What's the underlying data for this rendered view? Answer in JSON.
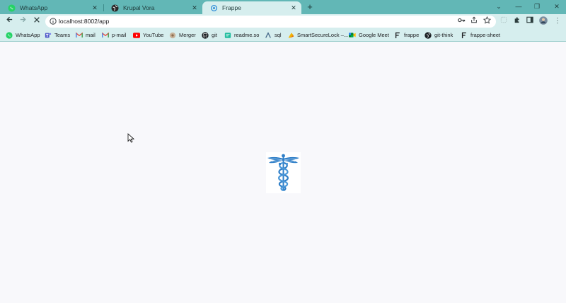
{
  "tabs": [
    {
      "title": "WhatsApp",
      "icon": "whatsapp-icon",
      "active": false
    },
    {
      "title": "Krupal Vora",
      "icon": "globe-icon",
      "active": false
    },
    {
      "title": "Frappe",
      "icon": "frappe-icon",
      "active": true
    }
  ],
  "window_controls": {
    "dropdown": "⌄",
    "minimize": "—",
    "restore": "❐",
    "close": "✕"
  },
  "toolbar": {
    "url": "localhost:8002/app",
    "new_tab": "+"
  },
  "bookmarks": [
    {
      "label": "WhatsApp",
      "icon": "whatsapp-icon"
    },
    {
      "label": "Teams",
      "icon": "teams-icon"
    },
    {
      "label": "mail",
      "icon": "gmail-icon"
    },
    {
      "label": "p-mail",
      "icon": "gmail-icon"
    },
    {
      "label": "YouTube",
      "icon": "youtube-icon"
    },
    {
      "label": "Merger",
      "icon": "merger-icon"
    },
    {
      "label": "git",
      "icon": "github-icon"
    },
    {
      "label": "readme.so",
      "icon": "readme-icon"
    },
    {
      "label": "sql",
      "icon": "sql-icon"
    },
    {
      "label": "SmartSecureLock –...",
      "icon": "lock-app-icon"
    },
    {
      "label": "Google Meet",
      "icon": "google-meet-icon"
    },
    {
      "label": "frappe",
      "icon": "frappe-icon"
    },
    {
      "label": "git-think",
      "icon": "github-icon"
    },
    {
      "label": "frappe-sheet",
      "icon": "frappe-icon"
    }
  ],
  "page": {
    "logo": "caduceus-icon",
    "loading": true
  },
  "colors": {
    "tabstrip": "#62b7b6",
    "toolbar": "#d6eeee",
    "logo": "#2f7fc8"
  }
}
